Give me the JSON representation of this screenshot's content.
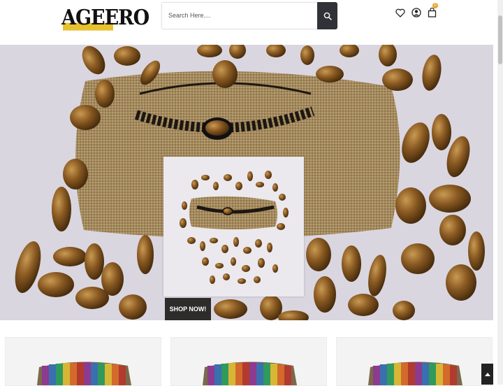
{
  "header": {
    "logo_text": "AGEERO",
    "search": {
      "placeholder": "Search Here....",
      "value": ""
    },
    "icons": [
      "heart-icon",
      "user-icon",
      "shopping-bag-icon"
    ],
    "cart_count": "0"
  },
  "hero": {
    "cta_label": "SHOP NOW!"
  },
  "colors": {
    "accent_yellow": "#e8c12f",
    "badge": "#e8a42f",
    "dark_button": "#2f3237",
    "cta_background": "#2e2b2b"
  },
  "products": {
    "visible_cards": 3
  }
}
